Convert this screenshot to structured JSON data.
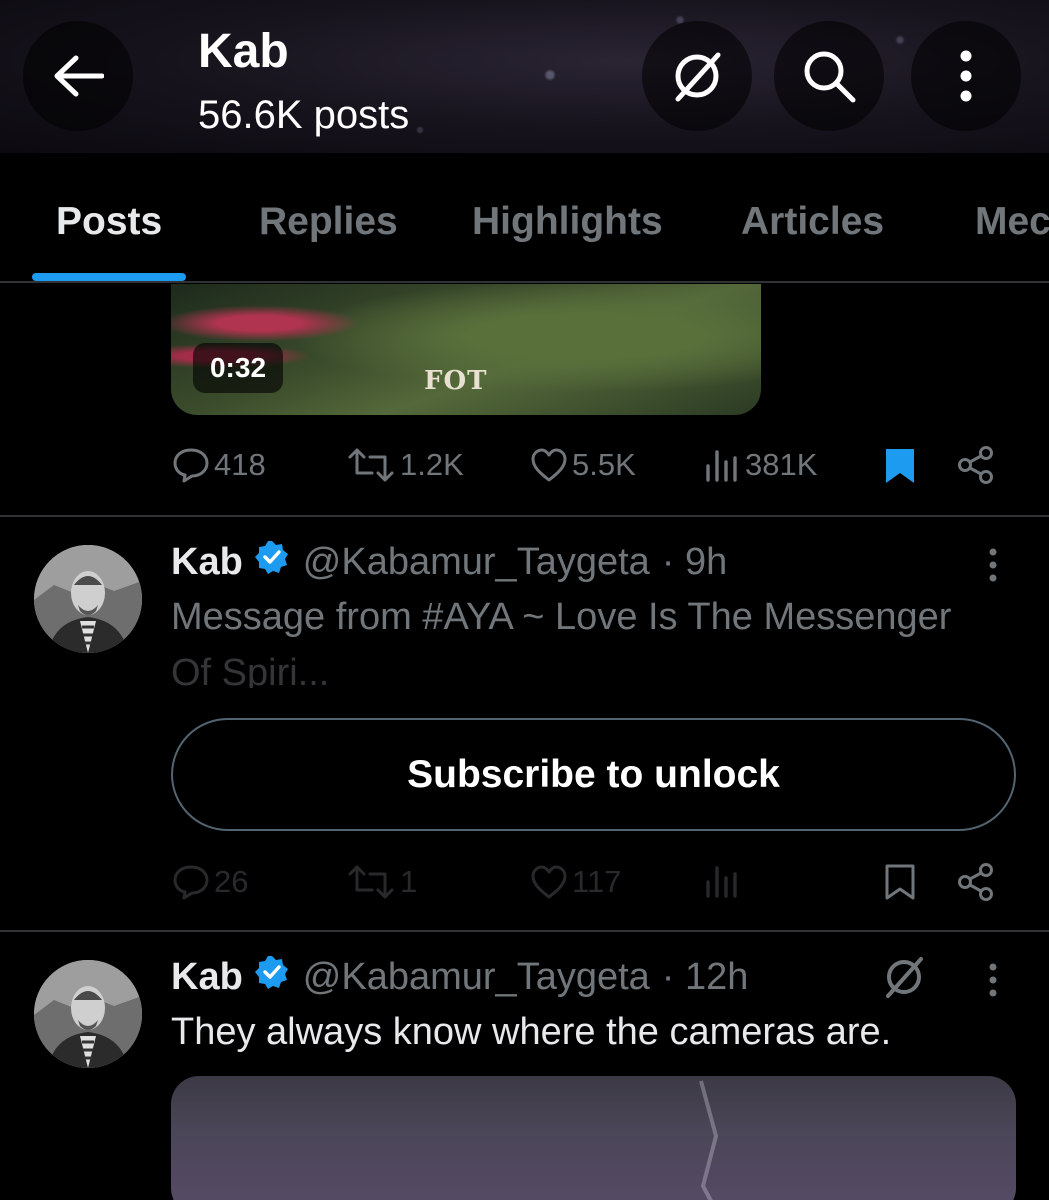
{
  "header": {
    "title": "Kab",
    "post_count": "56.6K posts"
  },
  "tabs": [
    {
      "label": "Posts",
      "active": true
    },
    {
      "label": "Replies",
      "active": false
    },
    {
      "label": "Highlights",
      "active": false
    },
    {
      "label": "Articles",
      "active": false
    },
    {
      "label": "Mec",
      "active": false
    }
  ],
  "post1": {
    "video_duration": "0:32",
    "watermark": "FOT",
    "replies": "418",
    "reposts": "1.2K",
    "likes": "5.5K",
    "views": "381K",
    "bookmarked": true
  },
  "post2": {
    "name": "Kab",
    "handle": "@Kabamur_Taygeta",
    "time": "· 9h",
    "text_line1": "Message from #AYA ~ Love Is The Messenger",
    "text_line2": "Of Spiri...",
    "subscribe_label": "Subscribe to unlock",
    "replies": "26",
    "reposts": "1",
    "likes": "117"
  },
  "post3": {
    "name": "Kab",
    "handle": "@Kabamur_Taygeta",
    "time": "· 12h",
    "text": "They always know where the cameras are."
  },
  "colors": {
    "accent": "#1d9bf0",
    "muted": "#71767b",
    "border": "#2f3336"
  }
}
